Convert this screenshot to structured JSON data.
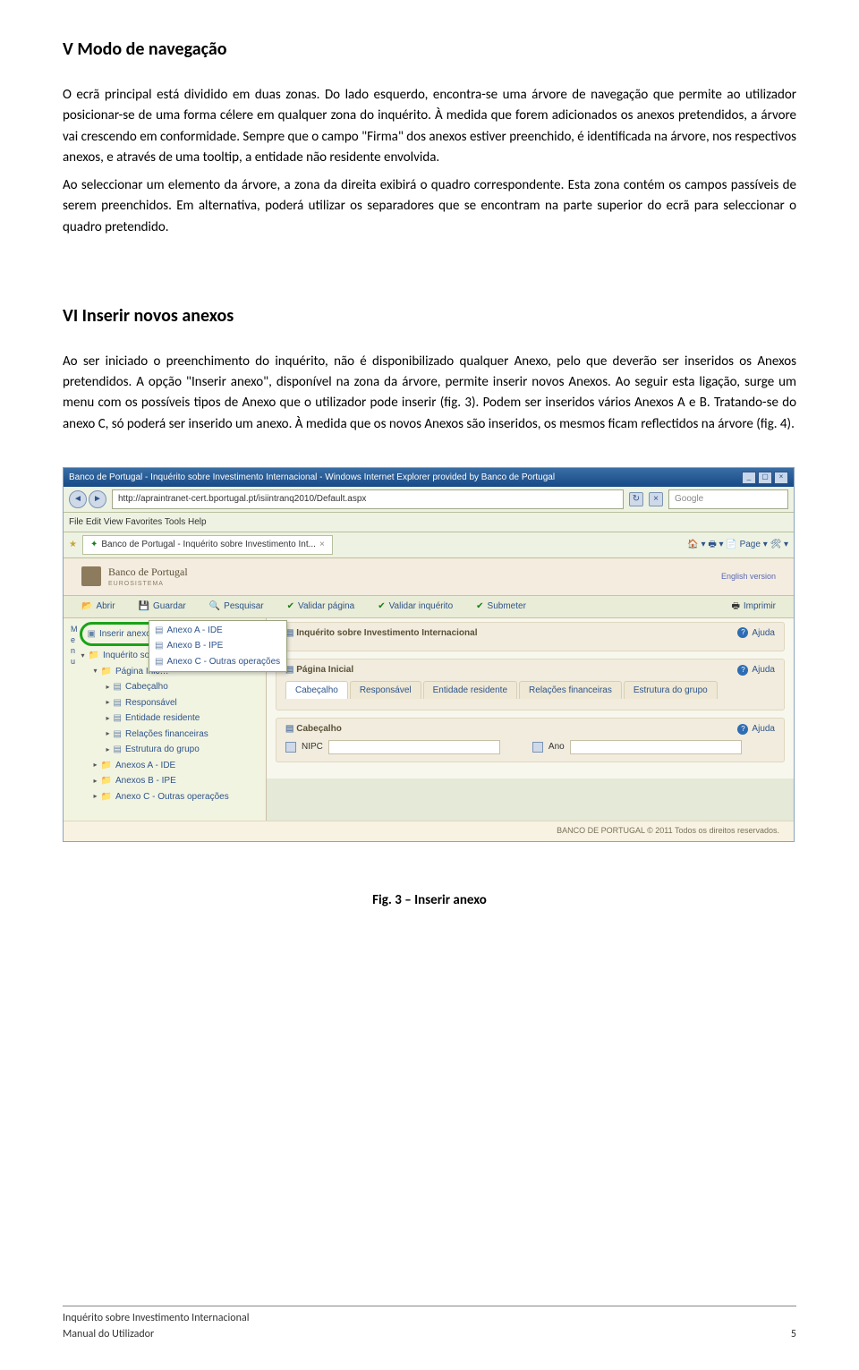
{
  "section_v": {
    "heading": "V    Modo de navegação",
    "p1": "O ecrã principal está dividido em duas zonas. Do lado esquerdo, encontra-se uma árvore de navegação que permite ao utilizador posicionar-se de uma forma célere em qualquer zona do inquérito. À medida que forem adicionados os anexos pretendidos, a árvore vai crescendo em conformidade. Sempre que o campo \"Firma\" dos anexos estiver preenchido, é identificada na árvore, nos respectivos anexos, e através de uma tooltip, a entidade não residente envolvida.",
    "p2": "Ao seleccionar um elemento da árvore, a zona da direita exibirá o quadro correspondente. Esta zona contém os campos passíveis de serem preenchidos. Em alternativa, poderá utilizar os separadores que se encontram na parte superior do ecrã para seleccionar o quadro pretendido."
  },
  "section_vi": {
    "heading": "VI   Inserir novos anexos",
    "p1": "Ao ser iniciado o preenchimento do inquérito, não é disponibilizado qualquer Anexo, pelo que deverão ser inseridos os Anexos pretendidos. A opção \"Inserir anexo\", disponível na zona da árvore, permite inserir novos Anexos. Ao seguir esta ligação, surge um menu com os possíveis tipos de Anexo que o utilizador pode inserir (fig. 3). Podem ser inseridos vários Anexos A e B. Tratando-se do anexo C, só poderá ser inserido um anexo. À medida que os novos Anexos são inseridos, os mesmos ficam reflectidos na árvore (fig. 4)."
  },
  "shot": {
    "titlebar": "Banco de Portugal - Inquérito sobre Investimento Internacional - Windows Internet Explorer provided by Banco de Portugal",
    "url": "http://apraintranet-cert.bportugal.pt/isiintranq2010/Default.aspx",
    "search_ph": "Google",
    "menu": "File   Edit   View   Favorites   Tools   Help",
    "tab": "Banco de Portugal - Inquérito sobre Investimento Int...",
    "tabtools": "🏠 ▾   🖶 ▾   📄 Page ▾   🛠 ▾",
    "bank": "Banco de Portugal",
    "euro": "EUROSISTEMA",
    "english": "English version",
    "toolbar": {
      "abrir": "Abrir",
      "guardar": "Guardar",
      "pesquisar": "Pesquisar",
      "validar_pagina": "Validar página",
      "validar_inquerito": "Validar inquérito",
      "submeter": "Submeter",
      "imprimir": "Imprimir"
    },
    "menuv": "M\ne\nn\nu",
    "tree": {
      "inserir": "Inserir anexo ▸",
      "inq": "Inquérito sob…",
      "pagina": "Página Inic…",
      "cabecalho": "Cabeçalho",
      "responsavel": "Responsável",
      "entidade": "Entidade residente",
      "relacoes": "Relações financeiras",
      "estrutura": "Estrutura do grupo",
      "anexoA": "Anexos A - IDE",
      "anexoB": "Anexos B - IPE",
      "anexoC": "Anexo C - Outras operações"
    },
    "popup": {
      "a": "Anexo A - IDE",
      "b": "Anexo B - IPE",
      "c": "Anexo C - Outras operações"
    },
    "panel1": {
      "title": "Inquérito sobre Investimento Internacional",
      "ajuda": "Ajuda"
    },
    "panel2": {
      "title": "Página Inicial",
      "ajuda": "Ajuda",
      "tabs": [
        "Cabeçalho",
        "Responsável",
        "Entidade residente",
        "Relações financeiras",
        "Estrutura do grupo"
      ]
    },
    "panel3": {
      "title": "Cabeçalho",
      "ajuda": "Ajuda",
      "label1": "NIPC",
      "label2": "Ano"
    },
    "copyright": "BANCO DE PORTUGAL © 2011 Todos os direitos reservados."
  },
  "figcaption": "Fig. 3 – Inserir anexo",
  "footer": {
    "line1": "Inquérito sobre Investimento Internacional",
    "line2": "Manual do Utilizador",
    "page": "5"
  }
}
